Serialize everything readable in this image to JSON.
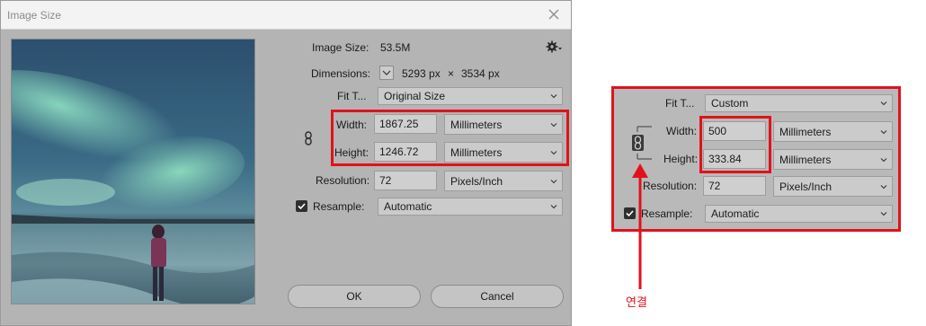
{
  "dialog": {
    "title": "Image Size",
    "image_size_label": "Image Size:",
    "image_size_value": "53.5M",
    "dimensions_label": "Dimensions:",
    "dimensions_width": "5293 px",
    "dimensions_sep": "×",
    "dimensions_height": "3534 px",
    "fit_label": "Fit T...",
    "fit_value": "Original Size",
    "width_label": "Width:",
    "width_value": "1867.25",
    "width_unit": "Millimeters",
    "height_label": "Height:",
    "height_value": "1246.72",
    "height_unit": "Millimeters",
    "resolution_label": "Resolution:",
    "resolution_value": "72",
    "resolution_unit": "Pixels/Inch",
    "resample_label": "Resample:",
    "resample_checked": true,
    "resample_value": "Automatic",
    "ok_label": "OK",
    "cancel_label": "Cancel"
  },
  "zoom": {
    "fit_label": "Fit T...",
    "fit_value": "Custom",
    "width_label": "Width:",
    "width_value": "500",
    "width_unit": "Millimeters",
    "height_label": "Height:",
    "height_value": "333.84",
    "height_unit": "Millimeters",
    "resolution_label": "Resolution:",
    "resolution_value": "72",
    "resolution_unit": "Pixels/Inch",
    "resample_label": "Resample:",
    "resample_value": "Automatic",
    "annotation": "연결"
  },
  "icons": {
    "settings": "gear-icon",
    "close": "close-icon",
    "chain": "chain-link-icon",
    "dropdown": "chevron-down-icon",
    "checkbox": "checkmark-icon"
  },
  "colors": {
    "dialog_bg": "#b4b4b4",
    "titlebar_bg": "#f3f3f3",
    "highlight": "#e1121b"
  }
}
